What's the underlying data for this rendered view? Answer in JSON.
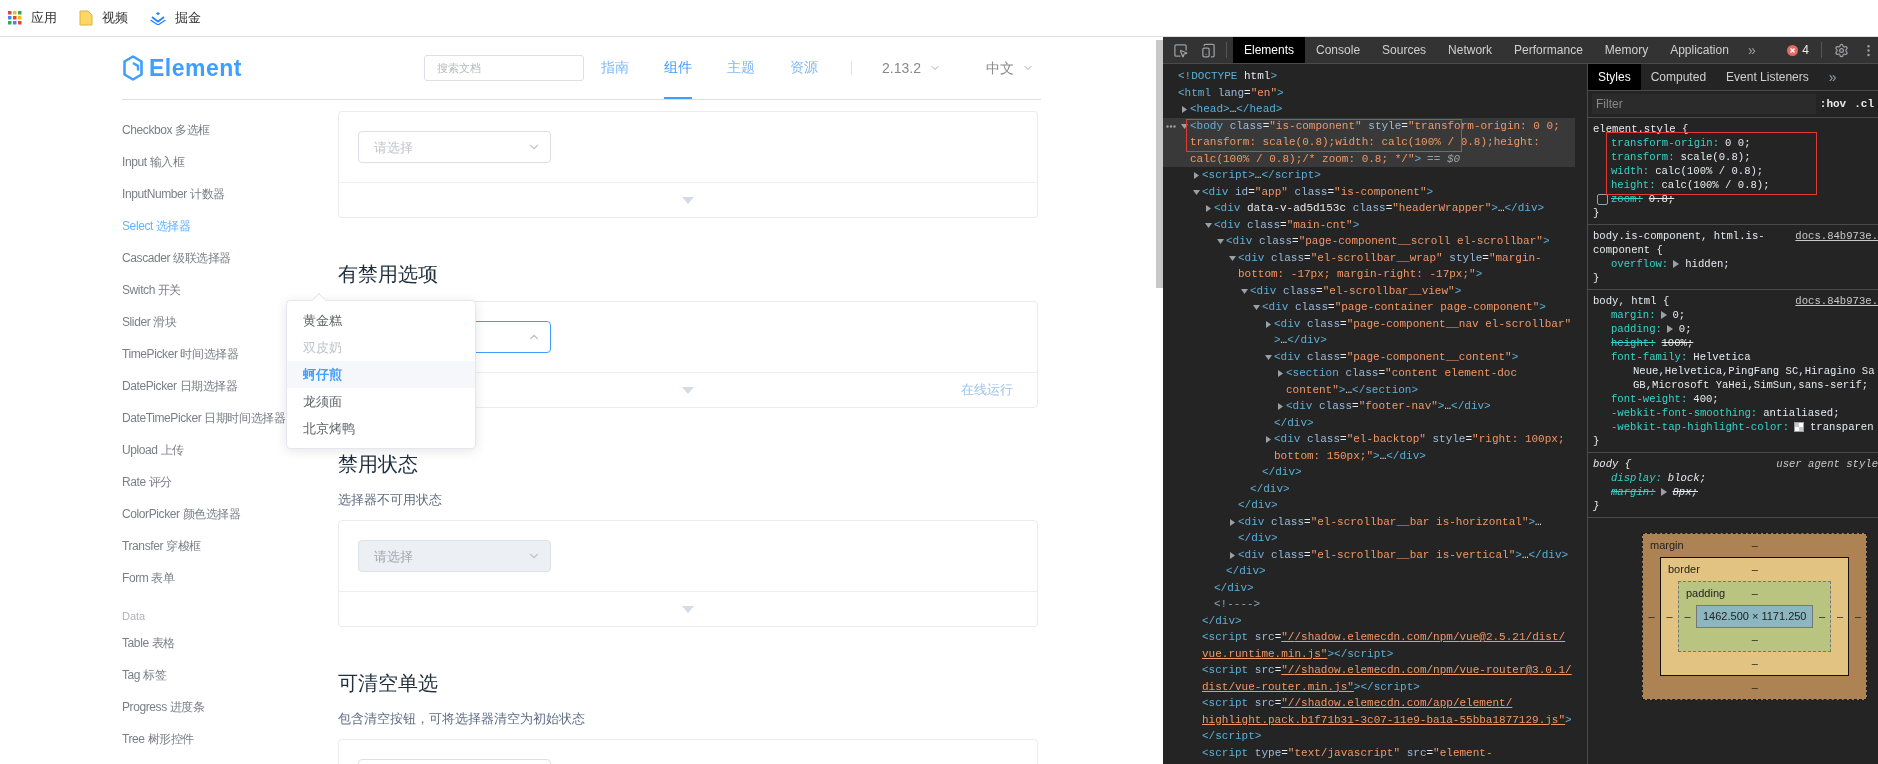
{
  "bookmarks": [
    {
      "label": "应用",
      "kind": "apps"
    },
    {
      "label": "视频",
      "kind": "folder"
    },
    {
      "label": "掘金",
      "kind": "juejin"
    }
  ],
  "header": {
    "logo": "Element",
    "search": {
      "placeholder": "搜索文档"
    },
    "nav": [
      {
        "label": "指南",
        "selected": false
      },
      {
        "label": "组件",
        "selected": true
      },
      {
        "label": "主题",
        "selected": false
      },
      {
        "label": "资源",
        "selected": false
      }
    ],
    "version": "2.13.2",
    "language": "中文"
  },
  "sidebar": {
    "groups": [
      {
        "items": [
          {
            "label": "Checkbox 多选框",
            "selected": false
          },
          {
            "label": "Input 输入框",
            "selected": false
          },
          {
            "label": "InputNumber 计数器",
            "selected": false
          },
          {
            "label": "Select 选择器",
            "selected": true
          },
          {
            "label": "Cascader 级联选择器",
            "selected": false
          },
          {
            "label": "Switch 开关",
            "selected": false
          },
          {
            "label": "Slider 滑块",
            "selected": false
          },
          {
            "label": "TimePicker 时间选择器",
            "selected": false
          },
          {
            "label": "DatePicker 日期选择器",
            "selected": false
          },
          {
            "label": "DateTimePicker 日期时间选择器",
            "selected": false
          },
          {
            "label": "Upload 上传",
            "selected": false
          },
          {
            "label": "Rate 评分",
            "selected": false
          },
          {
            "label": "ColorPicker 颜色选择器",
            "selected": false
          },
          {
            "label": "Transfer 穿梭框",
            "selected": false
          },
          {
            "label": "Form 表单",
            "selected": false
          }
        ]
      },
      {
        "title": "Data",
        "items": [
          {
            "label": "Table 表格",
            "selected": false
          },
          {
            "label": "Tag 标签",
            "selected": false
          },
          {
            "label": "Progress 进度条",
            "selected": false
          },
          {
            "label": "Tree 树形控件",
            "selected": false
          }
        ]
      }
    ]
  },
  "sections": [
    {
      "demo": {
        "select": {
          "open": false,
          "disabled": false,
          "placeholder": "请选择"
        }
      }
    },
    {
      "heading": "有禁用选项",
      "demo": {
        "select": {
          "open": true,
          "disabled": false
        },
        "run_label": "在线运行"
      }
    },
    {
      "heading": "禁用状态",
      "description": "选择器不可用状态",
      "demo": {
        "select": {
          "open": false,
          "disabled": true,
          "placeholder": "请选择"
        }
      }
    },
    {
      "heading": "可清空单选",
      "description": "包含清空按钮，可将选择器清空为初始状态",
      "demo": {
        "select": {
          "open": false,
          "disabled": false
        }
      }
    }
  ],
  "dropdown": {
    "options": [
      {
        "label": "黄金糕",
        "disabled": false,
        "selected": false
      },
      {
        "label": "双皮奶",
        "disabled": true,
        "selected": false
      },
      {
        "label": "蚵仔煎",
        "disabled": false,
        "selected": true
      },
      {
        "label": "龙须面",
        "disabled": false,
        "selected": false
      },
      {
        "label": "北京烤鸭",
        "disabled": false,
        "selected": false
      }
    ]
  },
  "devtools": {
    "tabs": [
      {
        "label": "Elements",
        "selected": true
      },
      {
        "label": "Console",
        "selected": false
      },
      {
        "label": "Sources",
        "selected": false
      },
      {
        "label": "Network",
        "selected": false
      },
      {
        "label": "Performance",
        "selected": false
      },
      {
        "label": "Memory",
        "selected": false
      },
      {
        "label": "Application",
        "selected": false
      }
    ],
    "more": "»",
    "errors": "4",
    "elements": {
      "nodes": [
        {
          "text": "<!DOCTYPE html>",
          "selected": false
        },
        {
          "text": "<html lang=\"en\">",
          "selected": false,
          "children": [
            {
              "text": "<head>…</head>",
              "expanded": false,
              "selected": false
            },
            {
              "text": "<body class=\"is-component\" style=\"transform-origin: 0 0; transform: scale(0.8);width: calc(100% / 0.8);height: calc(100% / 0.8);/* zoom: 0.8; */\">",
              "suffix": "== $0",
              "expanded": true,
              "selected": true,
              "children": [
                {
                  "text": "<script>…</script>",
                  "expanded": false,
                  "selected": false
                },
                {
                  "text": "<div id=\"app\" class=\"is-component\">",
                  "expanded": true,
                  "selected": false,
                  "close": "</div>",
                  "children": [
                    {
                      "text": "<div data-v-ad5d153c class=\"headerWrapper\">…</div>",
                      "expanded": false,
                      "selected": false
                    },
                    {
                      "text": "<div class=\"main-cnt\">",
                      "expanded": true,
                      "selected": false,
                      "close": "</div>",
                      "children": [
                        {
                          "text": "<div class=\"page-component__scroll el-scrollbar\">",
                          "expanded": true,
                          "selected": false,
                          "close": "</div>",
                          "children": [
                            {
                              "text": "<div class=\"el-scrollbar__wrap\" style=\"margin-bottom: -17px; margin-right: -17px;\">",
                              "expanded": true,
                              "selected": false,
                              "close": "</div>",
                              "children": [
                                {
                                  "text": "<div class=\"el-scrollbar__view\">",
                                  "expanded": true,
                                  "selected": false,
                                  "close": "</div>",
                                  "children": [
                                    {
                                      "text": "<div class=\"page-container page-component\">",
                                      "expanded": true,
                                      "selected": false,
                                      "close": "</div>",
                                      "children": [
                                        {
                                          "text": "<div class=\"page-component__nav el-scrollbar\">…</div>",
                                          "expanded": false,
                                          "selected": false
                                        },
                                        {
                                          "text": "<div class=\"page-component__content\">",
                                          "expanded": true,
                                          "selected": false,
                                          "close": "</div>",
                                          "children": [
                                            {
                                              "text": "<section class=\"content element-doc content\">…</section>",
                                              "expanded": false,
                                              "selected": false
                                            },
                                            {
                                              "text": "<div class=\"footer-nav\">…</div>",
                                              "expanded": false,
                                              "selected": false
                                            }
                                          ]
                                        },
                                        {
                                          "text": "<div class=\"el-backtop\" style=\"right: 100px; bottom: 150px;\">…</div>",
                                          "expanded": false,
                                          "selected": false
                                        }
                                      ]
                                    }
                                  ]
                                }
                              ]
                            },
                            {
                              "text": "<div class=\"el-scrollbar__bar is-horizontal\">…",
                              "close": "</div>",
                              "expanded": false,
                              "selected": false
                            },
                            {
                              "text": "<div class=\"el-scrollbar__bar is-vertical\">…</div>",
                              "expanded": false,
                              "selected": false
                            }
                          ]
                        }
                      ]
                    },
                    {
                      "text": "<!---->",
                      "selected": false
                    }
                  ]
                },
                {
                  "text": "<script src=\"//shadow.elemecdn.com/npm/vue@2.5.21/dist/vue.runtime.min.js\"></script>",
                  "link": true,
                  "selected": false
                },
                {
                  "text": "<script src=\"//shadow.elemecdn.com/npm/vue-router@3.0.1/dist/vue-router.min.js\"></script>",
                  "link": true,
                  "selected": false
                },
                {
                  "text": "<script src=\"//shadow.elemecdn.com/app/element/highlight.pack.b1f71b31-3c07-11e9-ba1a-55bba1877129.js\"></script>",
                  "link": true,
                  "selected": false
                },
                {
                  "text": "<script type=\"text/javascript\" src=\"element-",
                  "link": false,
                  "selected": false
                }
              ]
            }
          ]
        }
      ]
    },
    "styles": {
      "tabs": [
        {
          "label": "Styles",
          "selected": true
        },
        {
          "label": "Computed",
          "selected": false
        },
        {
          "label": "Event Listeners",
          "selected": false
        }
      ],
      "more": "»",
      "filter": {
        "placeholder": "Filter"
      },
      "toggles": [
        ":hov",
        ".cl"
      ],
      "rules": [
        {
          "kind": "inline",
          "selector": "element.style {",
          "close": "}",
          "declarations": [
            {
              "name": "transform-origin:",
              "value": "0 0;",
              "kind": "plain",
              "struck": false
            },
            {
              "name": "transform:",
              "value": "scale(0.8);",
              "kind": "plain",
              "struck": false
            },
            {
              "name": "width:",
              "value": "calc(100% / 0.8);",
              "kind": "plain",
              "struck": false
            },
            {
              "name": "height:",
              "value": "calc(100% / 0.8);",
              "kind": "plain",
              "struck": false
            },
            {
              "name": "zoom:",
              "value": "0.8;",
              "kind": "toggle",
              "checked": false,
              "struck": true
            }
          ]
        },
        {
          "kind": "author",
          "selector": "body.is-component, html.is-component {",
          "source": "docs.84b973e.",
          "close": "}",
          "declarations": [
            {
              "name": "overflow:",
              "value": "hidden;",
              "kind": "expandable",
              "struck": false
            }
          ]
        },
        {
          "kind": "author",
          "selector": "body, html {",
          "source": "docs.84b973e.",
          "close": "}",
          "declarations": [
            {
              "name": "margin:",
              "value": "0;",
              "kind": "expandable",
              "struck": false
            },
            {
              "name": "padding:",
              "value": "0;",
              "kind": "expandable",
              "struck": false
            },
            {
              "name": "height:",
              "value": "100%;",
              "kind": "plain",
              "struck": true
            },
            {
              "name": "font-family:",
              "value": "Helvetica",
              "continuation": [
                "Neue,Helvetica,PingFang SC,Hiragino Sa",
                "GB,Microsoft YaHei,SimSun,sans-serif;"
              ],
              "kind": "plain",
              "struck": false
            },
            {
              "name": "font-weight:",
              "value": "400;",
              "kind": "plain",
              "struck": false
            },
            {
              "name": "-webkit-font-smoothing:",
              "value": "antialiased;",
              "kind": "plain",
              "struck": false
            },
            {
              "name": "-webkit-tap-highlight-color:",
              "value": "transparen",
              "kind": "swatch",
              "struck": false
            }
          ]
        },
        {
          "kind": "user-agent",
          "selector": "body {",
          "source": "user agent style",
          "close": "}",
          "declarations": [
            {
              "name": "display:",
              "value": "block;",
              "kind": "plain",
              "struck": false
            },
            {
              "name": "margin:",
              "value": "8px;",
              "kind": "expandable",
              "struck": true
            }
          ]
        }
      ],
      "box_model": {
        "label": "margin",
        "top": "–",
        "left": "–",
        "inner": {
          "label": "border",
          "top": "–",
          "left": "–",
          "inner": {
            "label": "padding",
            "top": "–",
            "left": "–",
            "content": "1462.500 × 1171.250",
            "right": "–",
            "bottom": "–"
          },
          "right": "–",
          "bottom": "–"
        },
        "right": "–",
        "bottom": "–"
      }
    }
  }
}
